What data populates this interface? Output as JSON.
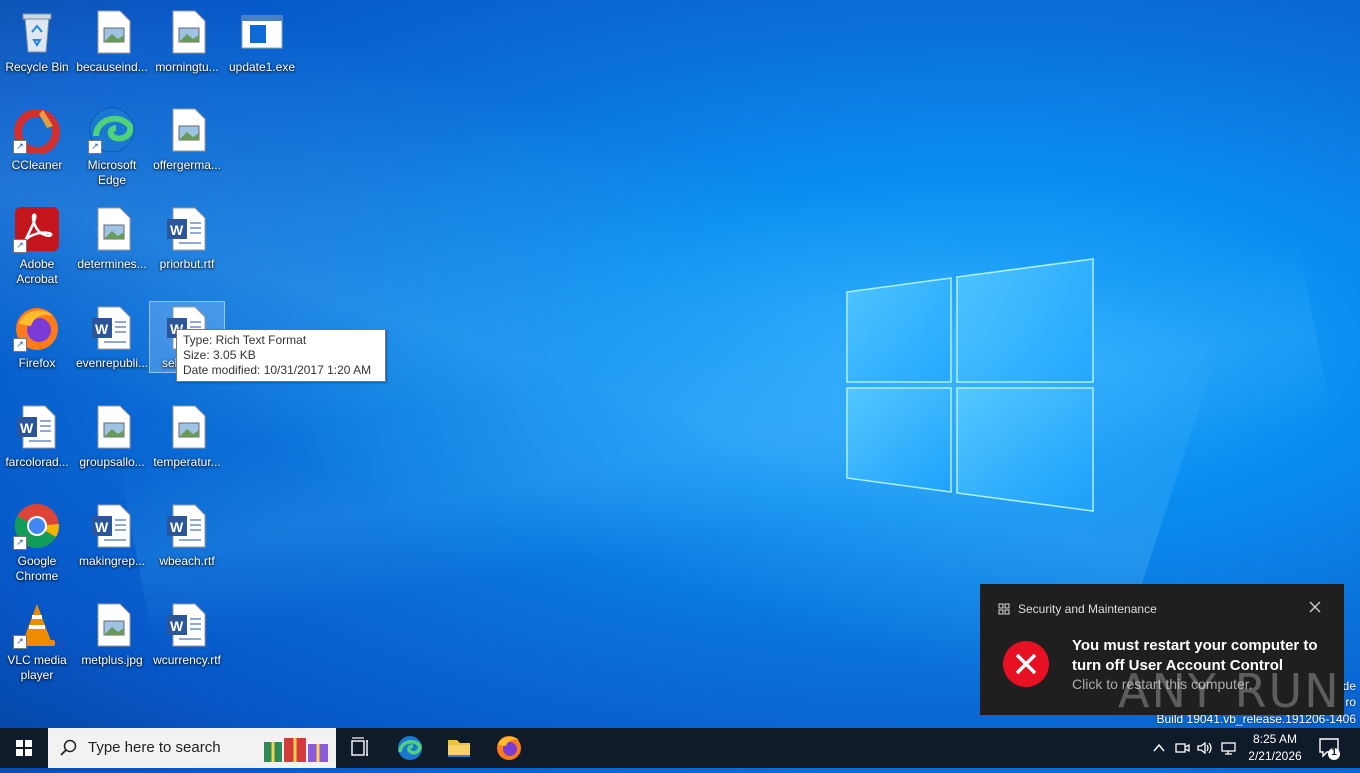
{
  "desktop": {
    "icons": [
      {
        "label": "Recycle Bin",
        "icon": "recycle-bin-icon"
      },
      {
        "label": "becauseind...",
        "icon": "image-file-icon"
      },
      {
        "label": "morningtu...",
        "icon": "image-file-icon"
      },
      {
        "label": "update1.exe",
        "icon": "exe-file-icon"
      },
      {
        "label": "CCleaner",
        "icon": "ccleaner-icon"
      },
      {
        "label": "Microsoft Edge",
        "icon": "edge-icon"
      },
      {
        "label": "offergerma...",
        "icon": "image-file-icon"
      },
      {
        "label": "Adobe Acrobat",
        "icon": "acrobat-icon"
      },
      {
        "label": "determines...",
        "icon": "image-file-icon"
      },
      {
        "label": "priorbut.rtf",
        "icon": "word-file-icon"
      },
      {
        "label": "Firefox",
        "icon": "firefox-icon"
      },
      {
        "label": "evenrepubli...",
        "icon": "word-file-icon"
      },
      {
        "label": "sel",
        "icon": "word-file-icon"
      },
      {
        "label": "farcolorad...",
        "icon": "word-file-icon"
      },
      {
        "label": "groupsallo...",
        "icon": "image-file-icon"
      },
      {
        "label": "temperatur...",
        "icon": "image-file-icon"
      },
      {
        "label": "Google Chrome",
        "icon": "chrome-icon"
      },
      {
        "label": "makingrep...",
        "icon": "word-file-icon"
      },
      {
        "label": "wbeach.rtf",
        "icon": "word-file-icon"
      },
      {
        "label": "VLC media player",
        "icon": "vlc-icon"
      },
      {
        "label": "metplus.jpg",
        "icon": "image-file-icon"
      },
      {
        "label": "wcurrency.rtf",
        "icon": "word-file-icon"
      }
    ]
  },
  "tooltip": {
    "type": "Type: Rich Text Format",
    "size": "Size: 3.05 KB",
    "modified": "Date modified: 10/31/2017 1:20 AM"
  },
  "toast": {
    "app": "Security and Maintenance",
    "title": "You must restart your computer to turn off User Account Control",
    "body": "Click to restart this computer."
  },
  "watermark": "ANY RUN",
  "build": {
    "line1": "de",
    "line2": "ro",
    "line3": "Build 19041.vb_release.191206-1406"
  },
  "taskbar": {
    "search_placeholder": "Type here to search",
    "time": "8:25 AM",
    "date": "2/21/2026",
    "notification_count": "1"
  },
  "colors": {
    "taskbar": "#101b2a",
    "toast_bg": "#1f1f1f",
    "error_red": "#e81123"
  }
}
